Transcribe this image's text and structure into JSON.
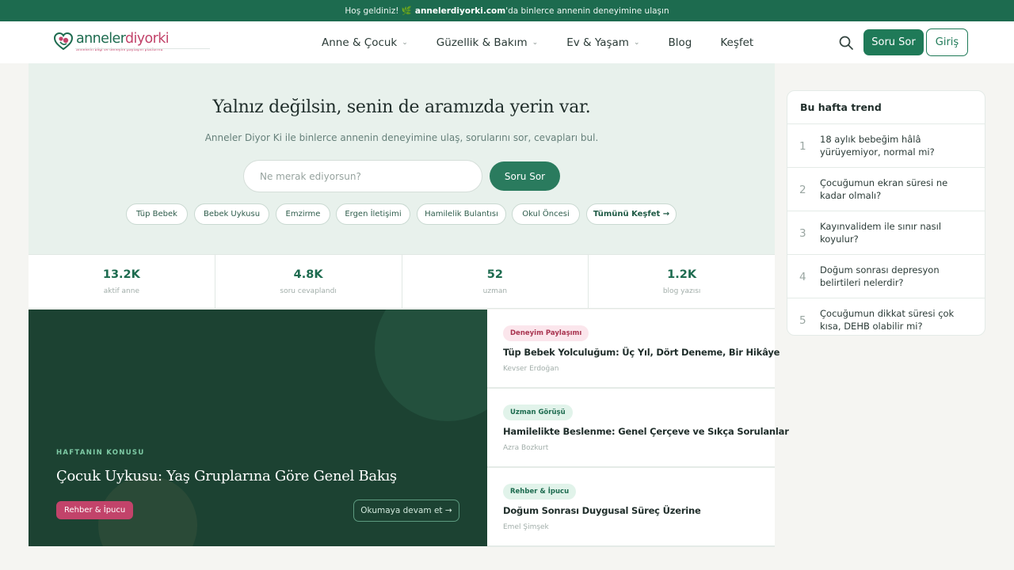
{
  "topbar": {
    "pre": "Hoş geldiniz! 🌿",
    "brand": "annelerdiyorki.com",
    "post": "'da binlerce annenin deneyimine ulaşın"
  },
  "logo": {
    "part1": "anneler",
    "part2": "diyorki",
    "tagline": "annelerin bilgi ve deneyim paylaşım platformu"
  },
  "nav": [
    {
      "label": "Anne & Çocuk",
      "has_dropdown": true
    },
    {
      "label": "Güzellik & Bakım",
      "has_dropdown": true
    },
    {
      "label": "Ev & Yaşam",
      "has_dropdown": true
    },
    {
      "label": "Blog",
      "has_dropdown": false
    },
    {
      "label": "Keşfet",
      "has_dropdown": false
    }
  ],
  "header": {
    "ask_label": "Soru Sor",
    "login_label": "Giriş",
    "search_icon": "search-icon"
  },
  "hero": {
    "title": "Yalnız değilsin, senin de aramızda yerin var.",
    "subtitle": "Anneler Diyor Ki ile binlerce annenin deneyimine ulaş, sorularını sor, cevapları bul.",
    "placeholder": "Ne merak ediyorsun?",
    "ask_label": "Soru Sor",
    "tags": [
      "Tüp Bebek",
      "Bebek Uykusu",
      "Emzirme",
      "Ergen İletişimi",
      "Hamilelik Bulantısı",
      "Okul Öncesi"
    ],
    "all_tags_label": "Tümünü Keşfet →"
  },
  "stats": [
    {
      "value": "13.2K",
      "label": "aktif anne"
    },
    {
      "value": "4.8K",
      "label": "soru cevaplandı"
    },
    {
      "value": "52",
      "label": "uzman"
    },
    {
      "value": "1.2K",
      "label": "blog yazısı"
    }
  ],
  "feature": {
    "kicker": "HAFTANIN KONUSU",
    "title": "Çocuk Uykusu: Yaş Gruplarına Göre Genel Bakış",
    "badge": "Rehber & İpucu",
    "more_label": "Okumaya devam et →"
  },
  "articles": [
    {
      "category": "Deneyim Paylaşımı",
      "category_style": "pink",
      "title": "Tüp Bebek Yolculuğum: Üç Yıl, Dört Deneme, Bir Hikâye",
      "author": "Kevser Erdoğan"
    },
    {
      "category": "Uzman Görüşü",
      "category_style": "green",
      "title": "Hamilelikte Beslenme: Genel Çerçeve ve Sıkça Sorulanlar",
      "author": "Azra Bozkurt"
    },
    {
      "category": "Rehber & İpucu",
      "category_style": "green",
      "title": "Doğum Sonrası Duygusal Süreç Üzerine",
      "author": "Emel Şimşek"
    }
  ],
  "trend": {
    "title": "Bu hafta trend",
    "items": [
      {
        "rank": "1",
        "text": "18 aylık bebeğim hâlâ yürüyemiyor, normal mi?"
      },
      {
        "rank": "2",
        "text": "Çocuğumun ekran süresi ne kadar olmalı?"
      },
      {
        "rank": "3",
        "text": "Kayınvalidem ile sınır nasıl koyulur?"
      },
      {
        "rank": "4",
        "text": "Doğum sonrası depresyon belirtileri nelerdir?"
      },
      {
        "rank": "5",
        "text": "Çocuğumun dikkat süresi çok kısa, DEHB olabilir mi?"
      }
    ]
  },
  "colors": {
    "brand_green": "#1d6b4f",
    "brand_pink": "#c2436a",
    "hero_bg": "#e8f1ec",
    "feature_bg": "#1c4232"
  }
}
